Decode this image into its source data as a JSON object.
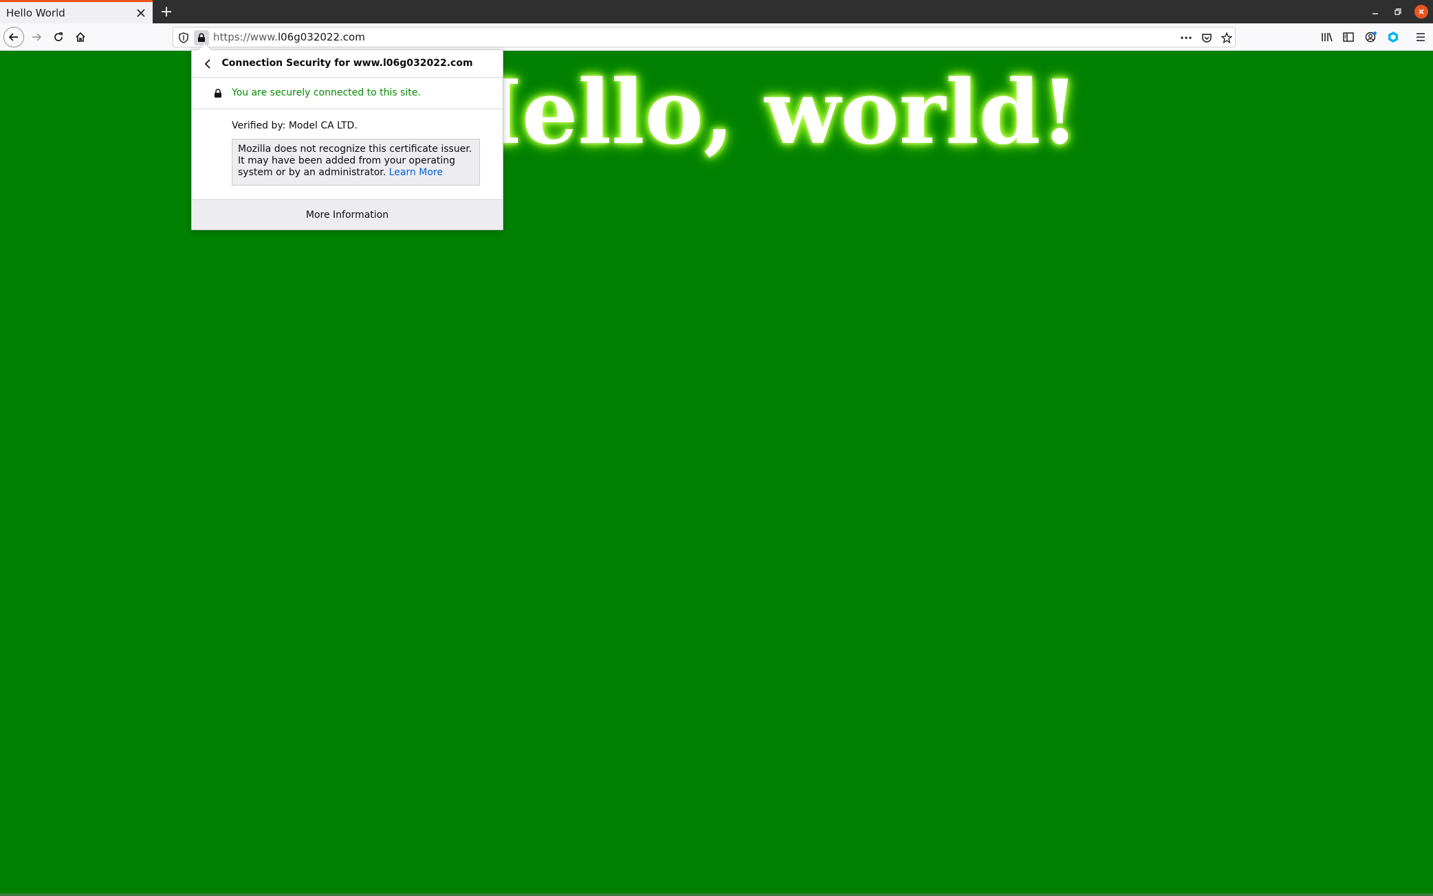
{
  "tab": {
    "title": "Hello World",
    "close_icon": "close-icon",
    "new_tab_icon": "plus-icon"
  },
  "window_controls": [
    "minimize-icon",
    "restore-icon",
    "close-icon"
  ],
  "toolbar": {
    "url_prefix": "https://www.",
    "url_host": "l06g032022.com",
    "icons_left": [
      "back-arrow-icon",
      "forward-arrow-icon",
      "reload-icon",
      "home-icon"
    ],
    "icons_url": [
      "shield-icon",
      "lock-icon"
    ],
    "icons_url_right": [
      "more-icon",
      "pocket-icon",
      "star-icon"
    ],
    "icons_right": [
      "library-icon",
      "sidebar-icon",
      "account-icon",
      "extension-icon",
      "menu-icon"
    ]
  },
  "page": {
    "heading": "Hello, world!",
    "background_color": "#008000"
  },
  "popup": {
    "title": "Connection Security for www.l06g032022.com",
    "secure_text": "You are securely connected to this site.",
    "verified_by": "Verified by: Model CA LTD.",
    "warning": "Mozilla does not recognize this certificate issuer. It may have been added from your operating system or by an administrator.",
    "learn_more": "Learn More",
    "more_info": "More Information",
    "secure_color": "#058b00",
    "link_color": "#0060df"
  }
}
